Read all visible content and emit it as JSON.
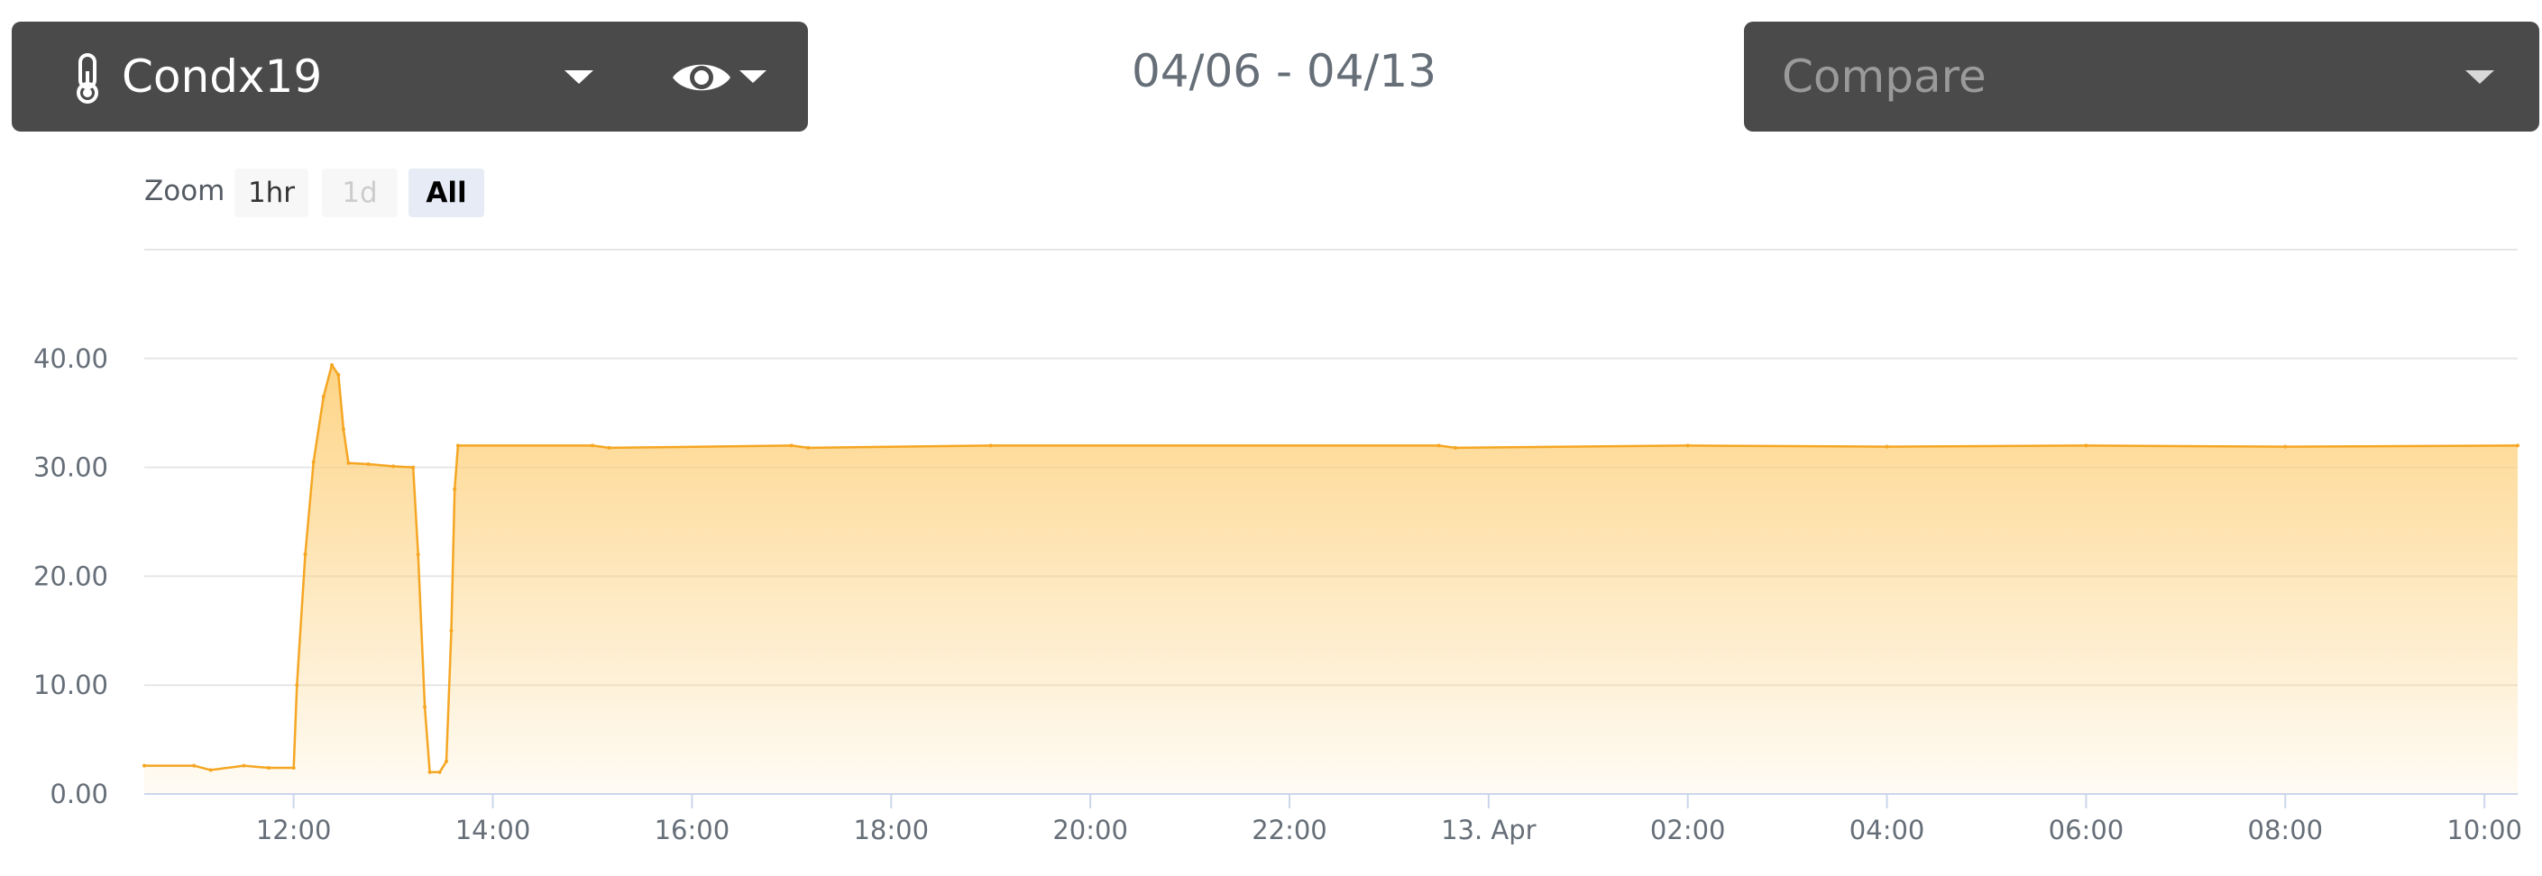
{
  "sensor": {
    "name": "Condx19",
    "icon": "thermometer-icon",
    "view_icon": "eye-icon"
  },
  "date_range": "04/06 - 04/13",
  "compare": {
    "placeholder": "Compare"
  },
  "zoom": {
    "label": "Zoom",
    "buttons": [
      "1hr",
      "1d",
      "All"
    ],
    "active": "All",
    "disabled": "1d"
  },
  "colors": {
    "panel": "#4a4a4a",
    "series": "#f5a623",
    "fill_top": "#fdd07a",
    "grid": "#e6e6e6"
  },
  "chart_data": {
    "type": "area",
    "title": "",
    "xlabel": "",
    "ylabel": "",
    "ylim": [
      0,
      50
    ],
    "yticks": [
      0,
      10,
      20,
      30,
      40
    ],
    "ytick_labels": [
      "0.00",
      "10.00",
      "20.00",
      "30.00",
      "40.00"
    ],
    "xlim": [
      "2023-04-12T10:30",
      "2023-04-13T10:20"
    ],
    "xtick_labels": [
      "12:00",
      "14:00",
      "16:00",
      "18:00",
      "20:00",
      "22:00",
      "13. Apr",
      "02:00",
      "04:00",
      "06:00",
      "08:00",
      "10:00"
    ],
    "xtick_times": [
      "2023-04-12T12:00",
      "2023-04-12T14:00",
      "2023-04-12T16:00",
      "2023-04-12T18:00",
      "2023-04-12T20:00",
      "2023-04-12T22:00",
      "2023-04-13T00:00",
      "2023-04-13T02:00",
      "2023-04-13T04:00",
      "2023-04-13T06:00",
      "2023-04-13T08:00",
      "2023-04-13T10:00"
    ],
    "grid": true,
    "series": [
      {
        "points": [
          [
            "2023-04-12T10:30",
            2.6
          ],
          [
            "2023-04-12T11:00",
            2.6
          ],
          [
            "2023-04-12T11:10",
            2.2
          ],
          [
            "2023-04-12T11:30",
            2.6
          ],
          [
            "2023-04-12T11:45",
            2.4
          ],
          [
            "2023-04-12T12:00",
            2.4
          ],
          [
            "2023-04-12T12:02",
            10.0
          ],
          [
            "2023-04-12T12:07",
            22.0
          ],
          [
            "2023-04-12T12:12",
            30.5
          ],
          [
            "2023-04-12T12:18",
            36.5
          ],
          [
            "2023-04-12T12:23",
            39.4
          ],
          [
            "2023-04-12T12:27",
            38.5
          ],
          [
            "2023-04-12T12:30",
            33.5
          ],
          [
            "2023-04-12T12:33",
            30.4
          ],
          [
            "2023-04-12T12:45",
            30.3
          ],
          [
            "2023-04-12T13:00",
            30.1
          ],
          [
            "2023-04-12T13:12",
            30.0
          ],
          [
            "2023-04-12T13:15",
            22.0
          ],
          [
            "2023-04-12T13:19",
            8.0
          ],
          [
            "2023-04-12T13:22",
            2.0
          ],
          [
            "2023-04-12T13:28",
            2.0
          ],
          [
            "2023-04-12T13:32",
            3.0
          ],
          [
            "2023-04-12T13:35",
            15.0
          ],
          [
            "2023-04-12T13:37",
            28.0
          ],
          [
            "2023-04-12T13:39",
            32.0
          ],
          [
            "2023-04-12T15:00",
            32.0
          ],
          [
            "2023-04-12T15:10",
            31.8
          ],
          [
            "2023-04-12T17:00",
            32.0
          ],
          [
            "2023-04-12T17:10",
            31.8
          ],
          [
            "2023-04-12T19:00",
            32.0
          ],
          [
            "2023-04-12T23:30",
            32.0
          ],
          [
            "2023-04-12T23:40",
            31.8
          ],
          [
            "2023-04-13T02:00",
            32.0
          ],
          [
            "2023-04-13T04:00",
            31.9
          ],
          [
            "2023-04-13T06:00",
            32.0
          ],
          [
            "2023-04-13T08:00",
            31.9
          ],
          [
            "2023-04-13T10:20",
            32.0
          ]
        ]
      }
    ]
  }
}
